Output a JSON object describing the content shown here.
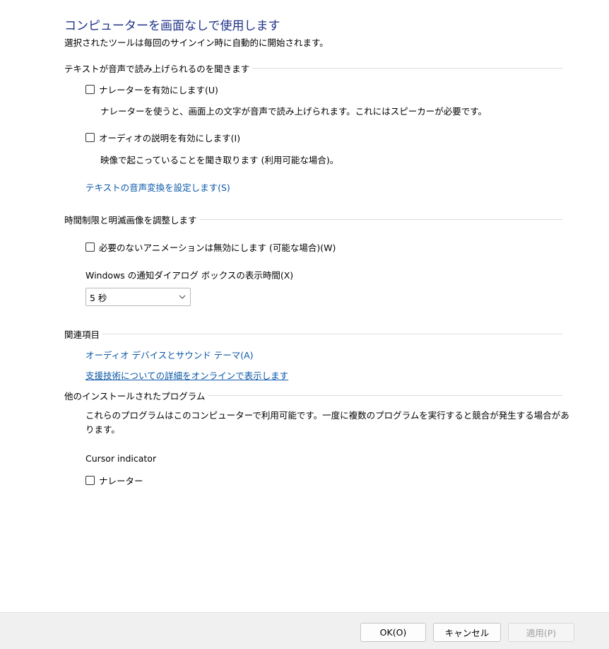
{
  "header": {
    "title": "コンピューターを画面なしで使用します",
    "subtitle": "選択されたツールは毎回のサインイン時に自動的に開始されます。"
  },
  "tts_group": {
    "header": "テキストが音声で読み上げられるのを聞きます",
    "narrator": {
      "label": "ナレーターを有効にします(U)",
      "checked": false,
      "description": "ナレーターを使うと、画面上の文字が音声で読み上げられます。これにはスピーカーが必要です。"
    },
    "audio_description": {
      "label": "オーディオの説明を有効にします(I)",
      "checked": false,
      "description": "映像で起こっていることを聞き取ります (利用可能な場合)。"
    },
    "tts_link": "テキストの音声変換を設定します(S)"
  },
  "timing_group": {
    "header": "時間制限と明滅画像を調整します",
    "animations": {
      "label": "必要のないアニメーションは無効にします (可能な場合)(W)",
      "checked": false
    },
    "notification_label": "Windows の通知ダイアログ ボックスの表示時間(X)",
    "notification_value": "5 秒"
  },
  "related_group": {
    "header": "関連項目",
    "link1": "オーディオ デバイスとサウンド テーマ(A)",
    "link2": "支援技術についての詳細をオンラインで表示します"
  },
  "other_group": {
    "header": "他のインストールされたプログラム",
    "description": "これらのプログラムはこのコンピューターで利用可能です。一度に複数のプログラムを実行すると競合が発生する場合があります。",
    "cursor_indicator": "Cursor indicator",
    "narrator": {
      "label": "ナレーター",
      "checked": false
    }
  },
  "footer": {
    "ok": "OK(O)",
    "cancel": "キャンセル",
    "apply": "適用(P)"
  },
  "colors": {
    "title": "#1e3287",
    "link": "#0b57a8",
    "footer_bg": "#f0f0f0"
  }
}
